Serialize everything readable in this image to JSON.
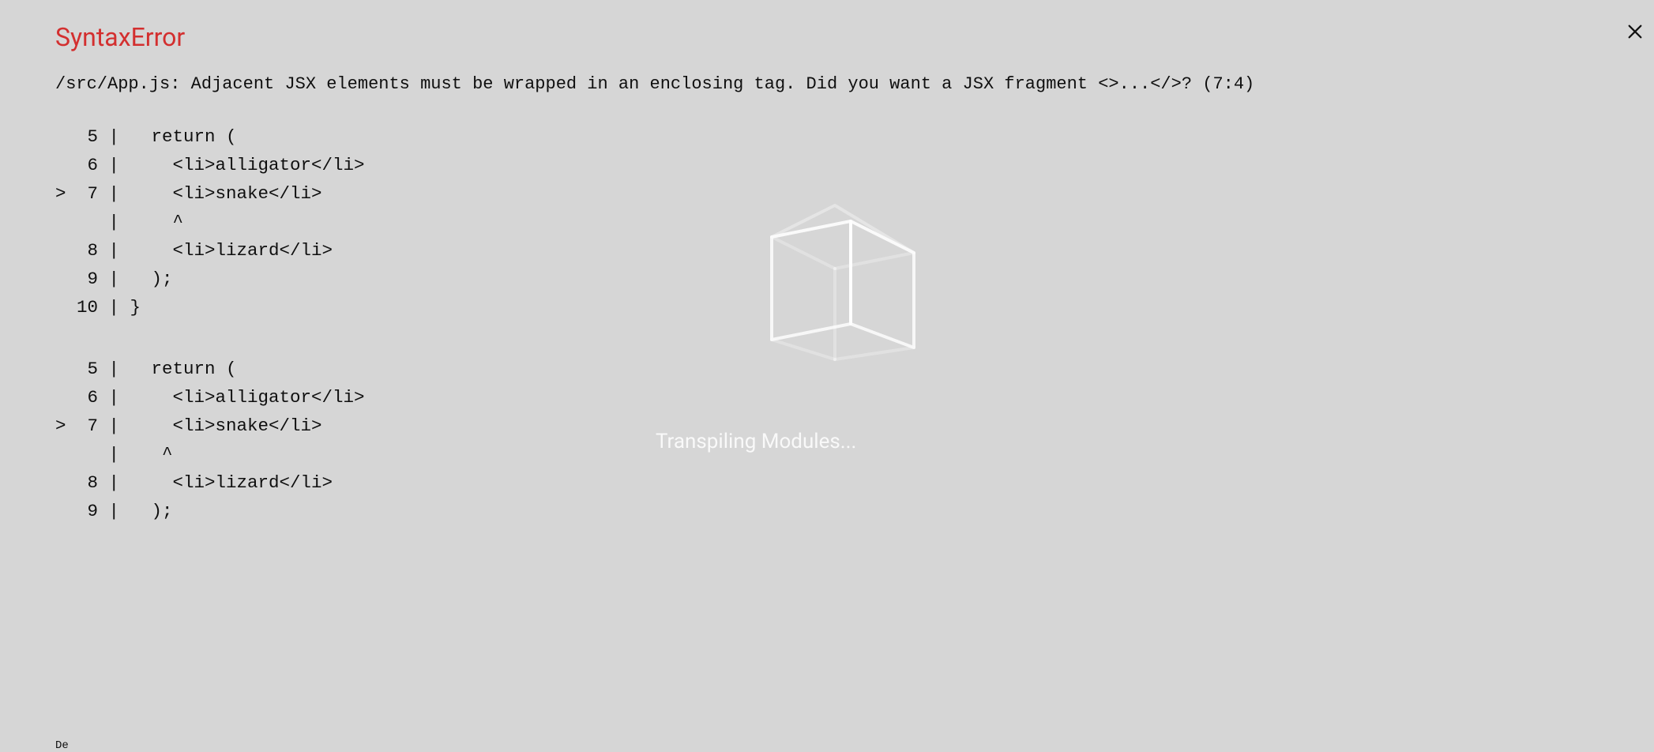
{
  "error": {
    "title": "SyntaxError",
    "message": "/src/App.js: Adjacent JSX elements must be wrapped in an enclosing tag. Did you want a JSX fragment <>...</>? (7:4)",
    "code_frame_1": "   5 |   return (\n   6 |     <li>alligator</li>\n>  7 |     <li>snake</li>\n     |     ^\n   8 |     <li>lizard</li>\n   9 |   );\n  10 | }",
    "code_frame_2": "   5 |   return (\n   6 |     <li>alligator</li>\n>  7 |     <li>snake</li>\n     |    ^\n   8 |     <li>lizard</li>\n   9 |   );",
    "cutoff_text": "De"
  },
  "overlay": {
    "status_text": "Transpiling Modules..."
  },
  "icons": {
    "close": "close-icon",
    "cube": "cube-icon"
  }
}
